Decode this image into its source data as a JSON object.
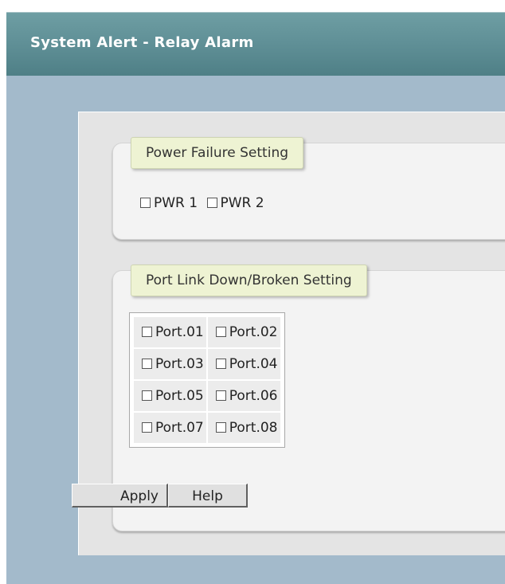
{
  "header": {
    "title": "System Alert - Relay Alarm"
  },
  "power_section": {
    "legend": "Power Failure Setting",
    "items": [
      {
        "label": "PWR 1",
        "checked": false
      },
      {
        "label": "PWR 2",
        "checked": false
      }
    ]
  },
  "port_section": {
    "legend": "Port Link Down/Broken Setting",
    "ports": [
      {
        "label": "Port.01",
        "checked": false
      },
      {
        "label": "Port.02",
        "checked": false
      },
      {
        "label": "Port.03",
        "checked": false
      },
      {
        "label": "Port.04",
        "checked": false
      },
      {
        "label": "Port.05",
        "checked": false
      },
      {
        "label": "Port.06",
        "checked": false
      },
      {
        "label": "Port.07",
        "checked": false
      },
      {
        "label": "Port.08",
        "checked": false
      }
    ]
  },
  "buttons": {
    "apply_label": "Apply",
    "help_label": "Help"
  }
}
